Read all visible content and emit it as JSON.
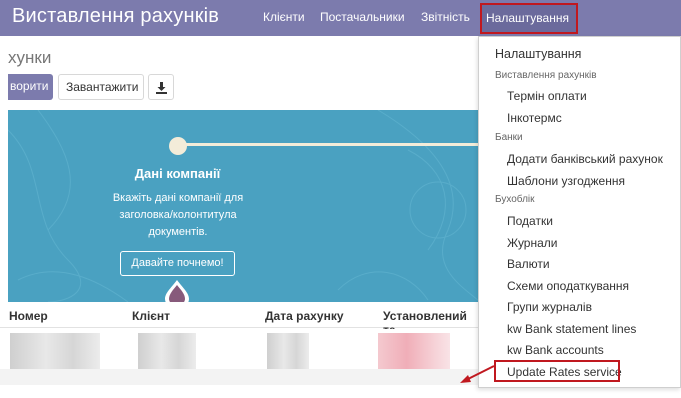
{
  "app": {
    "title": "Виставлення рахунків"
  },
  "top_menu": {
    "items": [
      "Клієнти",
      "Постачальники",
      "Звітність"
    ],
    "active": "Налаштування"
  },
  "breadcrumb": "хунки",
  "buttons": {
    "create": "ворити",
    "upload": "Завантажити",
    "download_icon": "download-icon"
  },
  "banner": {
    "title": "Дані компанії",
    "text_lines": [
      "Вкажіть дані компанії для",
      "заголовка/колонтитула",
      "документів."
    ],
    "button": "Давайте почнемо!"
  },
  "table": {
    "columns": [
      "Номер",
      "Клієнт",
      "Дата рахунку",
      "Установлений те"
    ]
  },
  "dropdown": {
    "top_item": "Налаштування",
    "sections": [
      {
        "header": "Виставлення рахунків",
        "items": [
          "Термін оплати",
          "Інкотермс"
        ]
      },
      {
        "header": "Банки",
        "items": [
          "Додати банківський рахунок",
          "Шаблони узгодження"
        ]
      },
      {
        "header": "Бухоблік",
        "items": [
          "Податки",
          "Журнали",
          "Валюти",
          "Схеми оподаткування",
          "Групи журналів",
          "kw Bank statement lines",
          "kw Bank accounts",
          "Update Rates service"
        ]
      }
    ]
  },
  "colors": {
    "navbar": "#7c7bad",
    "banner": "#4aa1c1",
    "highlight": "#c0181f"
  }
}
